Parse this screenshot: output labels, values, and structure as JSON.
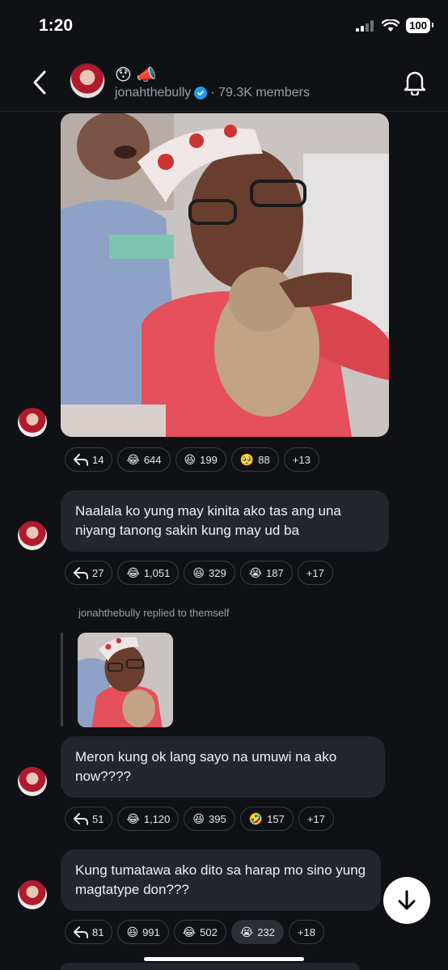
{
  "status": {
    "time": "1:20",
    "battery": "100"
  },
  "header": {
    "emojis": "😯📣",
    "username": "jonahthebully",
    "members": "· 79.3K members"
  },
  "posts": [
    {
      "reactions": [
        {
          "icon": "reply-icon",
          "count": "14"
        },
        {
          "emoji": "😂",
          "count": "644"
        },
        {
          "emoji": "😆",
          "count": "199"
        },
        {
          "emoji": "🥺",
          "count": "88"
        },
        {
          "more": "+13"
        }
      ]
    },
    {
      "text": "Naalala ko yung may kinita ako tas ang una niyang tanong sakin kung may ud ba",
      "reactions": [
        {
          "icon": "reply-icon",
          "count": "27"
        },
        {
          "emoji": "😂",
          "count": "1,051"
        },
        {
          "emoji": "😆",
          "count": "329"
        },
        {
          "emoji": "😭",
          "count": "187"
        },
        {
          "more": "+17"
        }
      ]
    },
    {
      "reply_label": "jonahthebully replied to themself",
      "text": "Meron kung ok lang sayo na umuwi na ako now????",
      "reactions": [
        {
          "icon": "reply-icon",
          "count": "51"
        },
        {
          "emoji": "😂",
          "count": "1,120"
        },
        {
          "emoji": "😆",
          "count": "395"
        },
        {
          "emoji": "🤣",
          "count": "157"
        },
        {
          "more": "+17"
        }
      ]
    },
    {
      "text": "Kung tumatawa ako dito sa harap mo sino yung magtatype don???",
      "reactions": [
        {
          "icon": "reply-icon",
          "count": "81"
        },
        {
          "emoji": "😆",
          "count": "991"
        },
        {
          "emoji": "😂",
          "count": "502"
        },
        {
          "emoji": "😭",
          "count": "232",
          "active": true
        },
        {
          "more": "+18"
        }
      ]
    }
  ],
  "colors": {
    "background": "#0f1115",
    "bubble": "#23262c",
    "verified": "#1d9bf0"
  }
}
